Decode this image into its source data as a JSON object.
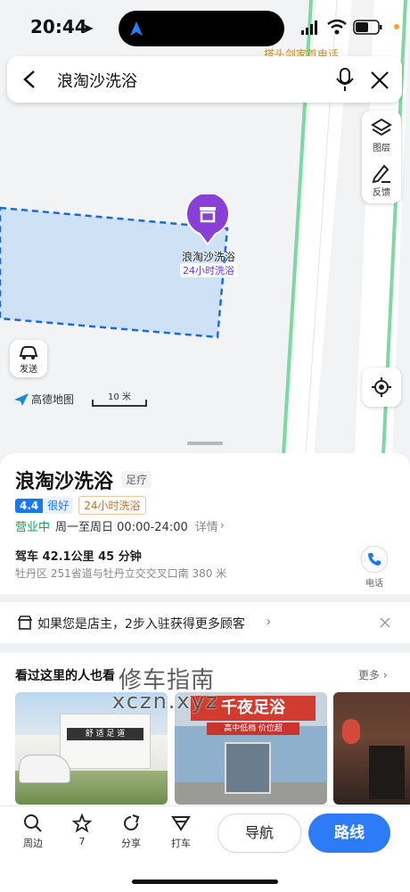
{
  "status_bar": {
    "time": "20:44"
  },
  "search": {
    "query": "浪淘沙洗浴"
  },
  "map": {
    "tools": {
      "layers_label": "图层",
      "feedback_label": "反馈"
    },
    "send_label": "发送",
    "brand": "高德地图",
    "scale": "10 米",
    "poi_name": "浪淘沙洗浴",
    "poi_tag": "24小时洗浴",
    "road_label": "搭头剑家首电话"
  },
  "place": {
    "name": "浪淘沙洗浴",
    "category": "足疗",
    "rating": "4.4",
    "rating_text": "很好",
    "hours_tag": "24小时洗浴",
    "open_status": "营业中",
    "hours": "周一至周日 00:00-24:00",
    "details_label": "详情",
    "drive": "驾车 42.1公里 45 分钟",
    "address": "牡丹区 251省道与牡丹立交交叉口南 380 米",
    "phone_label": "电话"
  },
  "owner_banner": {
    "text": "如果您是店主，2步入驻获得更多顾客"
  },
  "related": {
    "title": "看过这里的人也看",
    "more_label": "更多",
    "watermark_cn": "修车指南",
    "watermark_en": "xczn.xyz",
    "photos": [
      {
        "sign": "舒 适 足 道"
      },
      {
        "sign": "千夜足浴",
        "subsign": "高中低档 价位超"
      },
      {
        "sign": ""
      }
    ]
  },
  "bottom_bar": {
    "nearby": "周边",
    "favorite": "7",
    "share": "分享",
    "taxi": "打车",
    "navigate": "导航",
    "route": "路线"
  },
  "colors": {
    "accent": "#1a73e8",
    "route_btn": "#2d7bf6",
    "open_green": "#13a35b",
    "poi_purple": "#8a3fd6",
    "rating_bg": "#1677ff",
    "hours_tag": "#b8772a"
  }
}
